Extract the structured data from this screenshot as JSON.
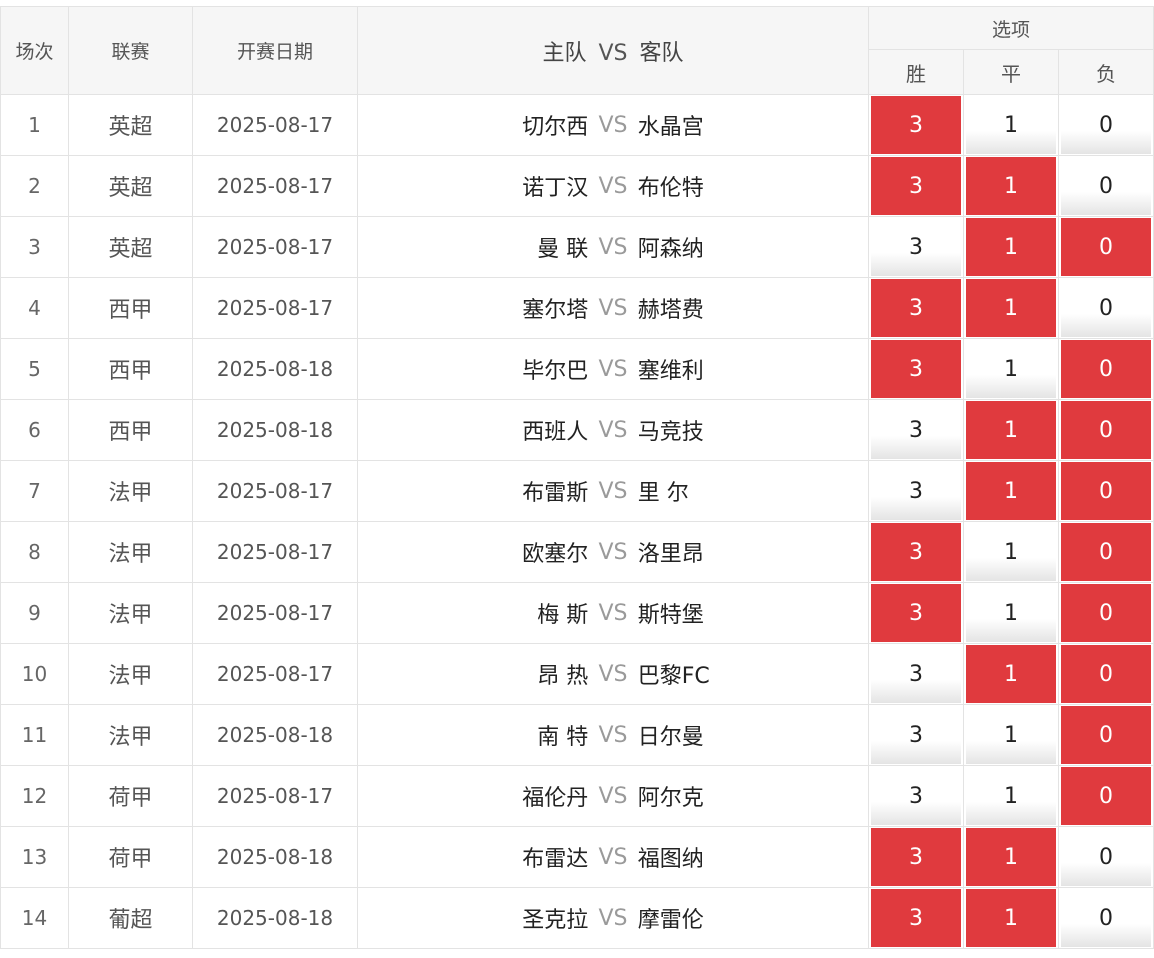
{
  "header": {
    "num": "场次",
    "league": "联赛",
    "date": "开赛日期",
    "home": "主队",
    "vs": "VS",
    "away": "客队",
    "options": "选项",
    "win": "胜",
    "draw": "平",
    "loss": "负"
  },
  "vs_label": "VS",
  "colors": {
    "selected": "#e03a3e",
    "header_bg": "#f6f6f6"
  },
  "rows": [
    {
      "num": "1",
      "league": "英超",
      "date": "2025-08-17",
      "home": "切尔西",
      "away": "水晶宫",
      "win": "3",
      "draw": "1",
      "loss": "0",
      "sel": [
        true,
        false,
        false
      ]
    },
    {
      "num": "2",
      "league": "英超",
      "date": "2025-08-17",
      "home": "诺丁汉",
      "away": "布伦特",
      "win": "3",
      "draw": "1",
      "loss": "0",
      "sel": [
        true,
        true,
        false
      ]
    },
    {
      "num": "3",
      "league": "英超",
      "date": "2025-08-17",
      "home": "曼 联",
      "away": "阿森纳",
      "win": "3",
      "draw": "1",
      "loss": "0",
      "sel": [
        false,
        true,
        true
      ]
    },
    {
      "num": "4",
      "league": "西甲",
      "date": "2025-08-17",
      "home": "塞尔塔",
      "away": "赫塔费",
      "win": "3",
      "draw": "1",
      "loss": "0",
      "sel": [
        true,
        true,
        false
      ]
    },
    {
      "num": "5",
      "league": "西甲",
      "date": "2025-08-18",
      "home": "毕尔巴",
      "away": "塞维利",
      "win": "3",
      "draw": "1",
      "loss": "0",
      "sel": [
        true,
        false,
        true
      ]
    },
    {
      "num": "6",
      "league": "西甲",
      "date": "2025-08-18",
      "home": "西班人",
      "away": "马竞技",
      "win": "3",
      "draw": "1",
      "loss": "0",
      "sel": [
        false,
        true,
        true
      ]
    },
    {
      "num": "7",
      "league": "法甲",
      "date": "2025-08-17",
      "home": "布雷斯",
      "away": "里 尔",
      "win": "3",
      "draw": "1",
      "loss": "0",
      "sel": [
        false,
        true,
        true
      ]
    },
    {
      "num": "8",
      "league": "法甲",
      "date": "2025-08-17",
      "home": "欧塞尔",
      "away": "洛里昂",
      "win": "3",
      "draw": "1",
      "loss": "0",
      "sel": [
        true,
        false,
        true
      ]
    },
    {
      "num": "9",
      "league": "法甲",
      "date": "2025-08-17",
      "home": "梅 斯",
      "away": "斯特堡",
      "win": "3",
      "draw": "1",
      "loss": "0",
      "sel": [
        true,
        false,
        true
      ]
    },
    {
      "num": "10",
      "league": "法甲",
      "date": "2025-08-17",
      "home": "昂 热",
      "away": "巴黎FC",
      "win": "3",
      "draw": "1",
      "loss": "0",
      "sel": [
        false,
        true,
        true
      ]
    },
    {
      "num": "11",
      "league": "法甲",
      "date": "2025-08-18",
      "home": "南 特",
      "away": "日尔曼",
      "win": "3",
      "draw": "1",
      "loss": "0",
      "sel": [
        false,
        false,
        true
      ]
    },
    {
      "num": "12",
      "league": "荷甲",
      "date": "2025-08-17",
      "home": "福伦丹",
      "away": "阿尔克",
      "win": "3",
      "draw": "1",
      "loss": "0",
      "sel": [
        false,
        false,
        true
      ]
    },
    {
      "num": "13",
      "league": "荷甲",
      "date": "2025-08-18",
      "home": "布雷达",
      "away": "福图纳",
      "win": "3",
      "draw": "1",
      "loss": "0",
      "sel": [
        true,
        true,
        false
      ]
    },
    {
      "num": "14",
      "league": "葡超",
      "date": "2025-08-18",
      "home": "圣克拉",
      "away": "摩雷伦",
      "win": "3",
      "draw": "1",
      "loss": "0",
      "sel": [
        true,
        true,
        false
      ]
    }
  ]
}
